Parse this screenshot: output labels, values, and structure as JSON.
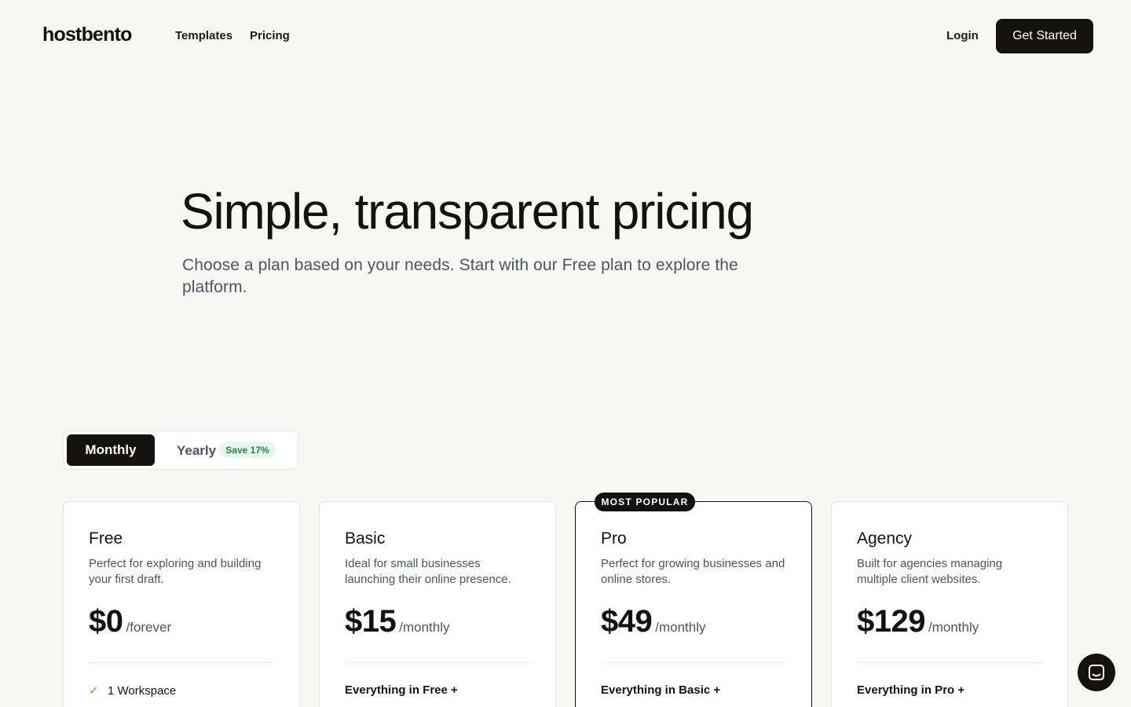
{
  "nav": {
    "logo": "hostbento",
    "links": [
      "Templates",
      "Pricing"
    ],
    "login": "Login",
    "cta": "Get Started"
  },
  "hero": {
    "title": "Simple, transparent pricing",
    "subtitle": "Choose a plan based on your needs. Start with our Free plan to explore the platform."
  },
  "billing_toggle": {
    "monthly": "Monthly",
    "yearly": "Yearly",
    "save_badge": "Save 17%",
    "selected": "Monthly"
  },
  "popular_badge": "MOST POPULAR",
  "plans": [
    {
      "name": "Free",
      "description": "Perfect for exploring and building your first draft.",
      "price": "$0",
      "period": "/forever",
      "first_feature": "1 Workspace"
    },
    {
      "name": "Basic",
      "description": "Ideal for small businesses launching their online presence.",
      "price": "$15",
      "period": "/monthly",
      "first_feature": "Everything in Free +"
    },
    {
      "name": "Pro",
      "description": "Perfect for growing businesses and online stores.",
      "price": "$49",
      "period": "/monthly",
      "first_feature": "Everything in Basic +"
    },
    {
      "name": "Agency",
      "description": "Built for agencies managing multiple client websites.",
      "price": "$129",
      "period": "/monthly",
      "first_feature": "Everything in Pro +"
    }
  ],
  "icons": {
    "feature_check": "check-icon",
    "chat": "chat-icon"
  },
  "colors": {
    "accent": "#141210",
    "check": "#e8672a",
    "save_bg": "#e6f7ec",
    "save_text": "#1f8a4c"
  }
}
